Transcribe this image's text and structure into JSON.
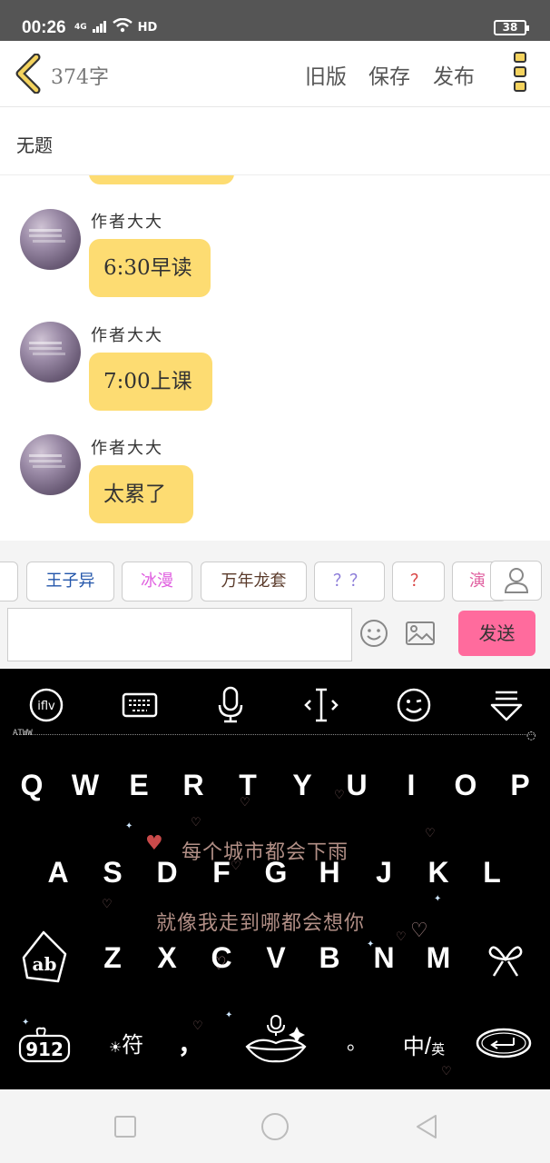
{
  "status": {
    "time": "00:26",
    "network": "4G",
    "hd": "HD",
    "battery": "38"
  },
  "header": {
    "count": "374字",
    "old_version": "旧版",
    "save": "保存",
    "publish": "发布"
  },
  "title": "无题",
  "messages": [
    {
      "author": "作者大大",
      "text": "6:30早读"
    },
    {
      "author": "作者大大",
      "text": "7:00上课"
    },
    {
      "author": "作者大大",
      "text": "太累了"
    }
  ],
  "tags": [
    {
      "label": "王子异",
      "color": "#2255aa"
    },
    {
      "label": "冰漫",
      "color": "#e060e0"
    },
    {
      "label": "万年龙套",
      "color": "#5a3a2a"
    },
    {
      "label": "？？",
      "color": "#8a7ad8"
    },
    {
      "label": "？",
      "color": "#d84040"
    },
    {
      "label": "演",
      "color": "#e060a0"
    }
  ],
  "input": {
    "placeholder": "",
    "send": "发送"
  },
  "keyboard": {
    "toolbar_label": "ATWW",
    "row1": [
      "Q",
      "W",
      "E",
      "R",
      "T",
      "Y",
      "U",
      "I",
      "O",
      "P"
    ],
    "row2": [
      "A",
      "S",
      "D",
      "F",
      "G",
      "H",
      "J",
      "K",
      "L"
    ],
    "row3": [
      "Z",
      "X",
      "C",
      "V",
      "B",
      "N",
      "M"
    ],
    "deco1": "每个城市都会下雨",
    "deco2": "就像我走到哪都会想你",
    "shift": "ab",
    "numbers": "912",
    "symbols": "符",
    "comma": "，",
    "period": "。",
    "lang_cn": "中",
    "lang_sep": "/",
    "lang_en": "英"
  },
  "colors": {
    "bubble": "#fddc72",
    "send": "#ff6b9d",
    "accent": "#f4d35e"
  },
  "icons": [
    "back-icon",
    "more-icon",
    "emoji-icon",
    "image-icon",
    "person-icon",
    "ifly-icon",
    "keyboard-icon",
    "mic-icon",
    "cursor-icon",
    "smile-icon",
    "hide-keyboard-icon",
    "delete-icon",
    "enter-icon"
  ]
}
